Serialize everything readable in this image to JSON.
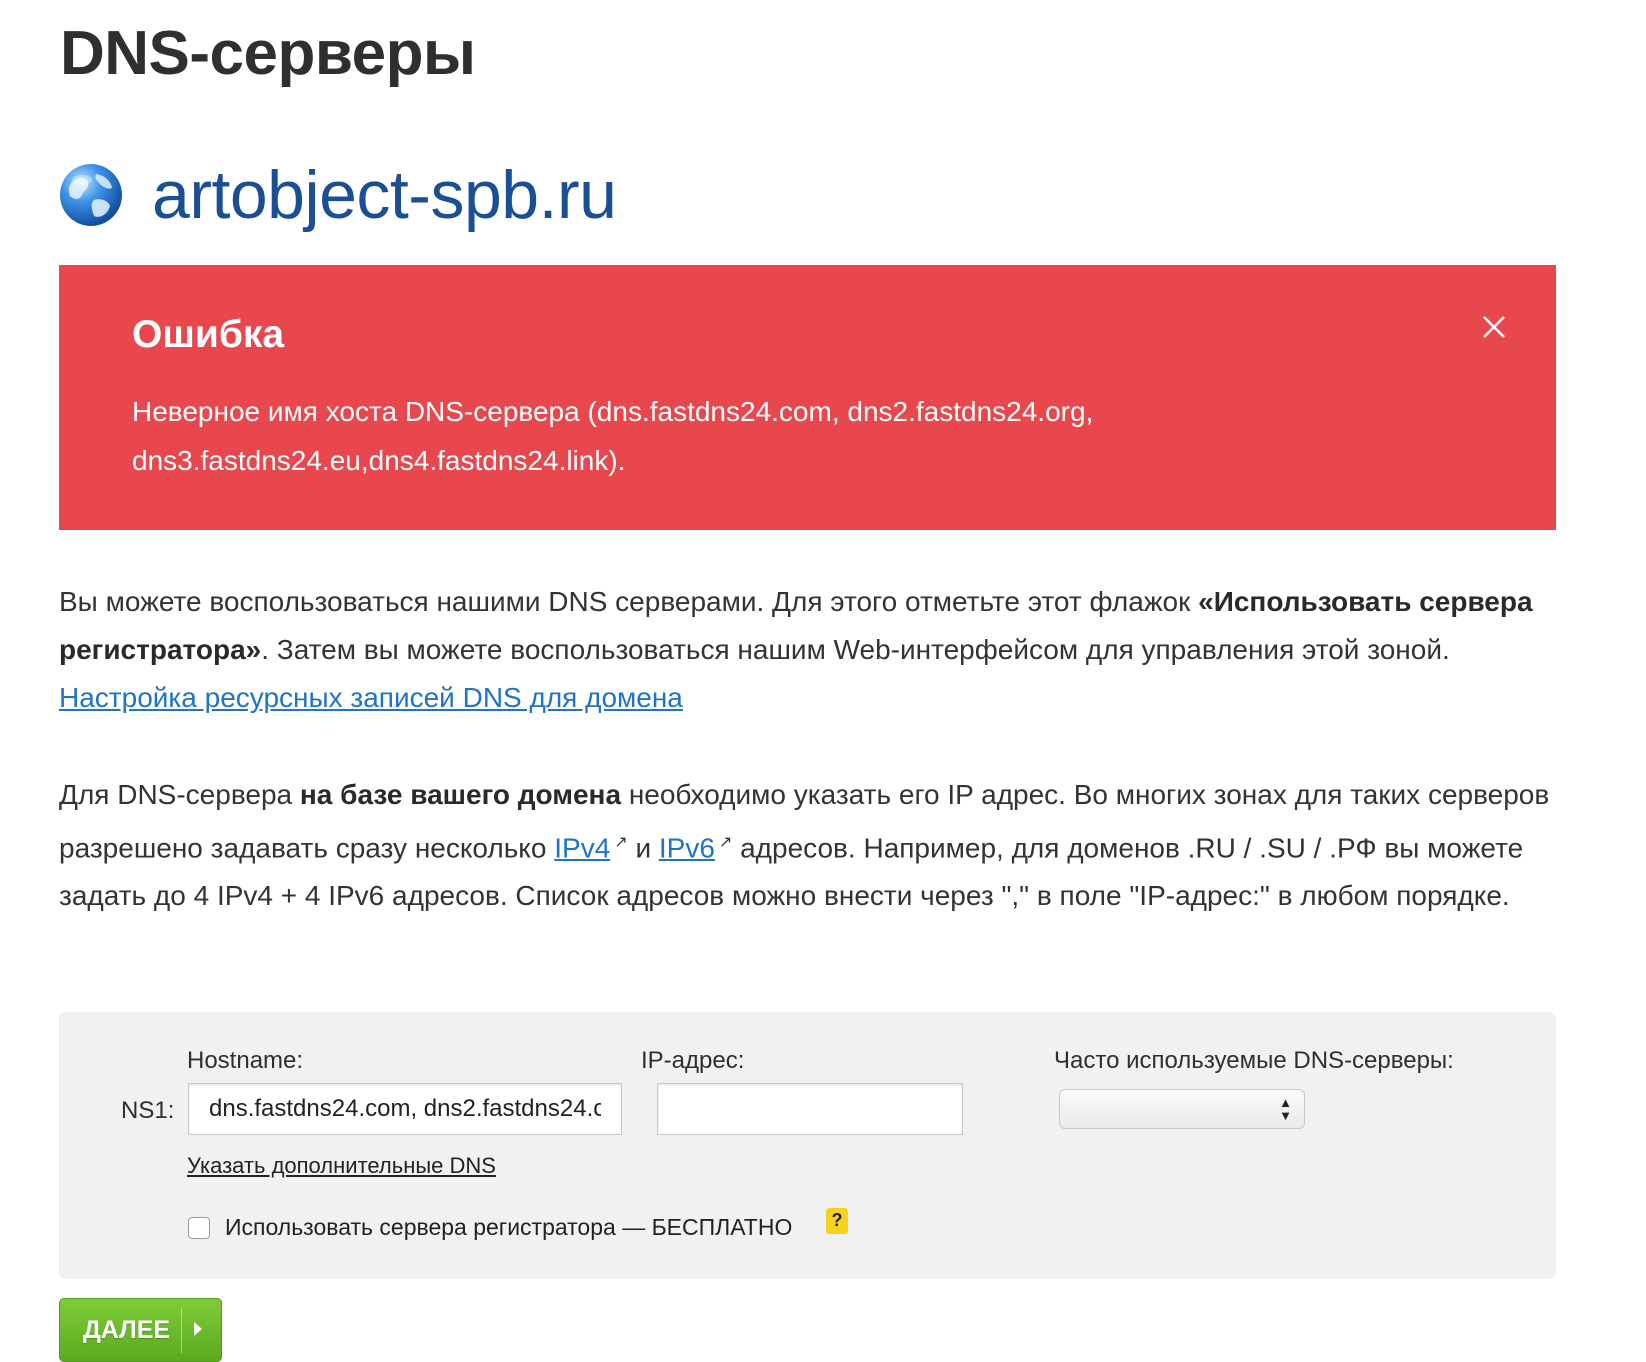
{
  "page": {
    "title": "DNS-серверы",
    "domain": "artobject-spb.ru"
  },
  "error": {
    "title": "Ошибка",
    "message": "Неверное имя хоста DNS-сервера (dns.fastdns24.com, dns2.fastdns24.org, dns3.fastdns24.eu,dns4.fastdns24.link)."
  },
  "info1": {
    "text_a": "Вы можете воспользоваться нашими DNS серверами. Для этого отметьте этот флажок ",
    "bold": "«Использовать сервера регистратора»",
    "text_b": ". Затем вы можете воспользоваться нашим Web-интерфейсом для управления этой зоной. ",
    "link": "Настройка ресурсных записей DNS для домена"
  },
  "info2": {
    "text_a": "Для DNS-сервера ",
    "bold": "на базе вашего домена",
    "text_b": " необходимо указать его IP адрес. Во многих зонах для таких серверов разрешено задавать сразу несколько ",
    "link_ipv4": "IPv4",
    "text_c": " и ",
    "link_ipv6": "IPv6",
    "text_d": " адресов. Например, для доменов .RU / .SU / .РФ вы можете задать до 4 IPv4 + 4 IPv6 адресов. Список адресов можно внести через \",\" в поле \"IP-адрес:\" в любом порядке."
  },
  "form": {
    "hostname_label": "Hostname:",
    "ip_label": "IP-адрес:",
    "common_dns_label": "Часто используемые DNS-серверы:",
    "row_label": "NS1:",
    "hostname_value": "dns.fastdns24.com, dns2.fastdns24.c",
    "ip_value": "",
    "common_dns_selected": "",
    "more_dns_link": "Указать дополнительные DNS",
    "checkbox_label": "Использовать сервера регистратора — БЕСПЛАТНО",
    "checkbox_checked": false,
    "help_symbol": "?"
  },
  "actions": {
    "next_label": "ДАЛЕЕ"
  },
  "colors": {
    "error_bg": "#e8484d",
    "domain": "#1a4f96",
    "link": "#1f74c7",
    "button_green": "#6bbd2c",
    "help_yellow": "#f7d21d"
  }
}
